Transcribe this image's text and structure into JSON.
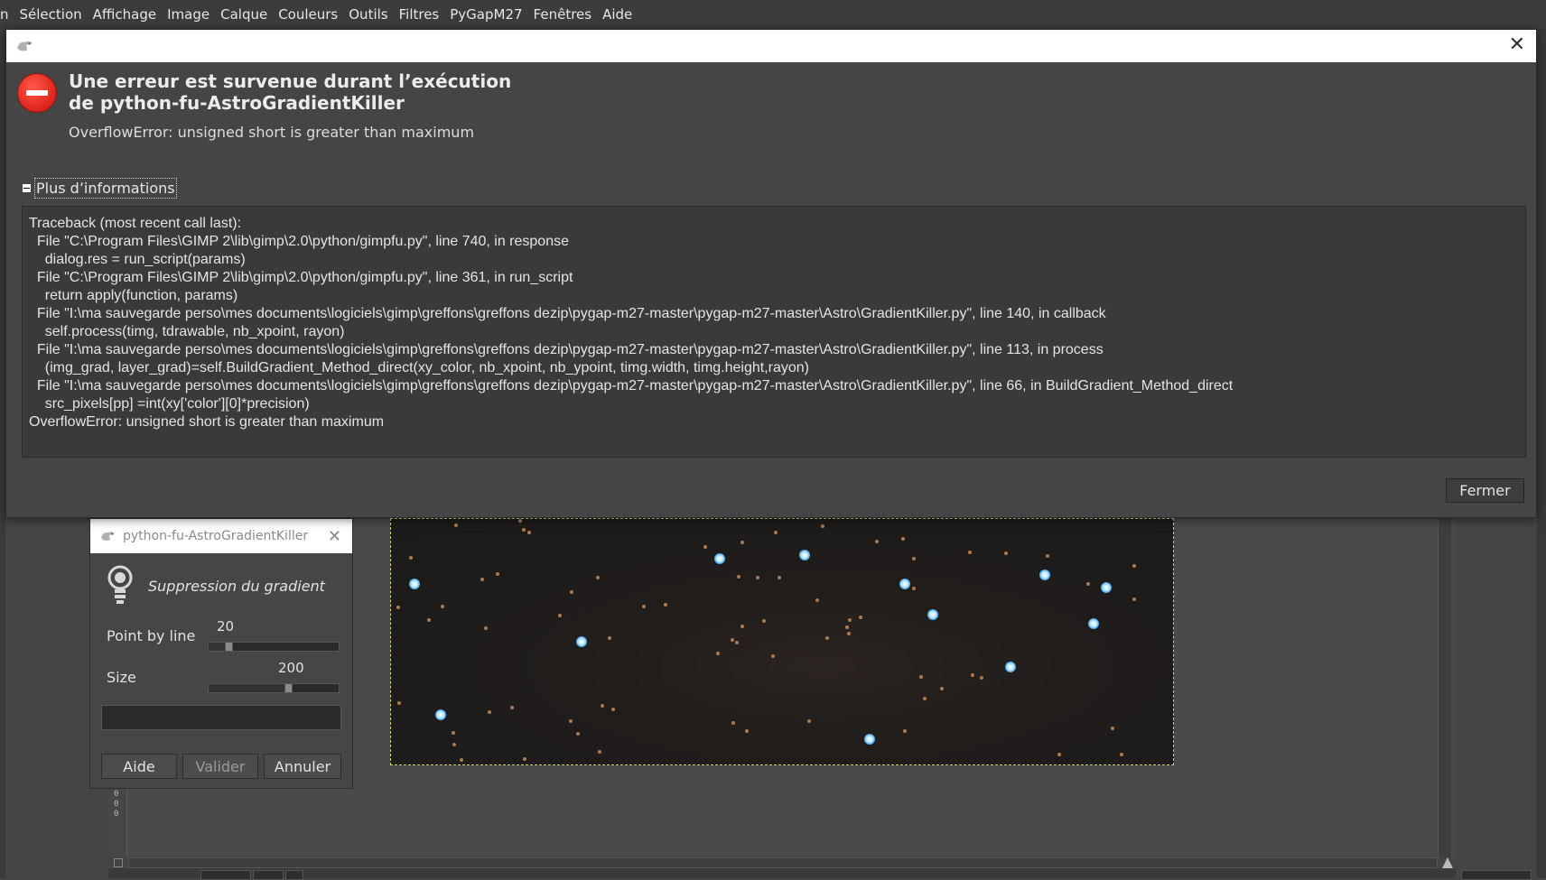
{
  "menubar": {
    "items": [
      {
        "label": "n"
      },
      {
        "label": "Sélection"
      },
      {
        "label": "Affichage"
      },
      {
        "label": "Image"
      },
      {
        "label": "Calque"
      },
      {
        "label": "Couleurs"
      },
      {
        "label": "Outils"
      },
      {
        "label": "Filtres"
      },
      {
        "label": "PyGapM27"
      },
      {
        "label": "Fenêtres"
      },
      {
        "label": "Aide"
      }
    ]
  },
  "error_dialog": {
    "title_line1": "Une erreur est survenue durant l’exécution",
    "title_line2": "de python-fu-AstroGradientKiller",
    "message": "OverflowError: unsigned short is greater than maximum",
    "expander_label": "Plus d’informations",
    "traceback_lines": [
      "Traceback (most recent call last):",
      "  File \"C:\\Program Files\\GIMP 2\\lib\\gimp\\2.0\\python/gimpfu.py\", line 740, in response",
      "    dialog.res = run_script(params)",
      "  File \"C:\\Program Files\\GIMP 2\\lib\\gimp\\2.0\\python/gimpfu.py\", line 361, in run_script",
      "    return apply(function, params)",
      "  File \"I:\\ma sauvegarde perso\\mes documents\\logiciels\\gimp\\greffons\\greffons dezip\\pygap-m27-master\\pygap-m27-master\\Astro\\GradientKiller.py\", line 140, in callback",
      "    self.process(timg, tdrawable, nb_xpoint, rayon)",
      "  File \"I:\\ma sauvegarde perso\\mes documents\\logiciels\\gimp\\greffons\\greffons dezip\\pygap-m27-master\\pygap-m27-master\\Astro\\GradientKiller.py\", line 113, in process",
      "    (img_grad, layer_grad)=self.BuildGradient_Method_direct(xy_color, nb_xpoint, nb_ypoint, timg.width, timg.height,rayon)",
      "  File \"I:\\ma sauvegarde perso\\mes documents\\logiciels\\gimp\\greffons\\greffons dezip\\pygap-m27-master\\pygap-m27-master\\Astro\\GradientKiller.py\", line 66, in BuildGradient_Method_direct",
      "    src_pixels[pp] =int(xy['color'][0]*precision)",
      "OverflowError: unsigned short is greater than maximum"
    ],
    "close_button": "Fermer",
    "close_icon": "close-icon",
    "error_icon": "error-icon"
  },
  "plugin_dialog": {
    "title": "python-fu-AstroGradientKiller",
    "subtitle": "Suppression du gradient",
    "params": [
      {
        "label": "Point by line",
        "value": "20",
        "level": 0.13
      },
      {
        "label": "Size",
        "value": "200",
        "level": 0.62
      }
    ],
    "buttons": {
      "help": "Aide",
      "ok": "Valider",
      "cancel": "Annuler"
    }
  },
  "ruler": {
    "ticks": [
      "0",
      "0",
      "0"
    ]
  },
  "colors": {
    "background": "#454545",
    "titlebar": "#ffffff",
    "error_red": "#e52d23",
    "star_blue": "#3aa0e8",
    "selection_dash": "#d8d36a"
  }
}
